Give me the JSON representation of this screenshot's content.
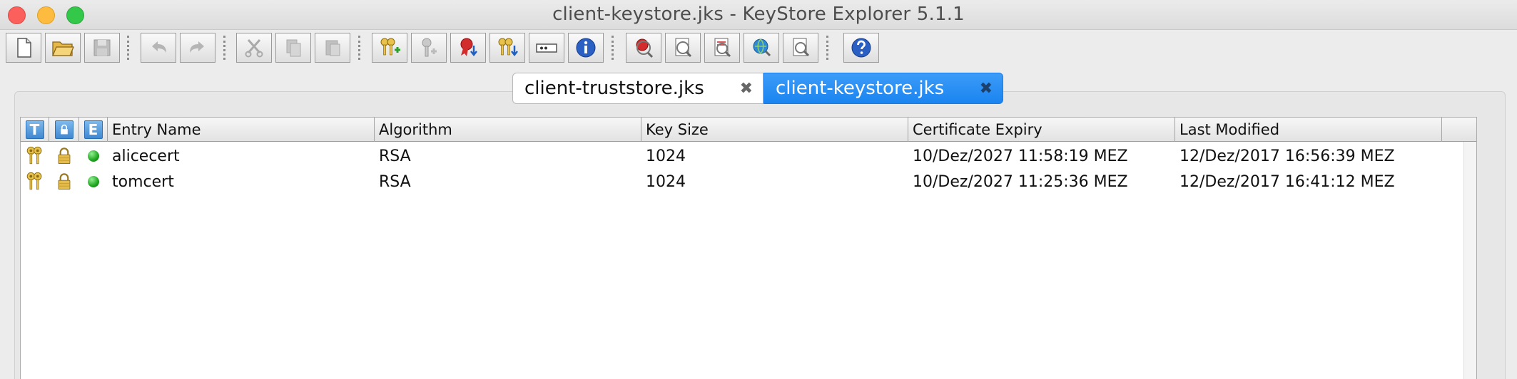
{
  "window": {
    "title": "client-keystore.jks - KeyStore Explorer 5.1.1"
  },
  "toolbar": {
    "buttons": [
      {
        "name": "new-keystore",
        "icon": "new-file-icon",
        "enabled": true
      },
      {
        "name": "open-keystore",
        "icon": "open-folder-icon",
        "enabled": true
      },
      {
        "name": "save-keystore",
        "icon": "save-disk-icon",
        "enabled": false
      },
      {
        "name": "undo",
        "icon": "undo-icon",
        "enabled": false
      },
      {
        "name": "redo",
        "icon": "redo-icon",
        "enabled": false
      },
      {
        "name": "cut",
        "icon": "scissors-icon",
        "enabled": false
      },
      {
        "name": "copy",
        "icon": "copy-icon",
        "enabled": false
      },
      {
        "name": "paste",
        "icon": "paste-icon",
        "enabled": false
      },
      {
        "name": "generate-keypair",
        "icon": "keypair-add-icon",
        "enabled": true
      },
      {
        "name": "generate-secret-key",
        "icon": "key-add-icon",
        "enabled": false
      },
      {
        "name": "import-trusted-cert",
        "icon": "certificate-import-icon",
        "enabled": true
      },
      {
        "name": "import-keypair",
        "icon": "keypair-import-icon",
        "enabled": true
      },
      {
        "name": "set-password",
        "icon": "password-icon",
        "enabled": true
      },
      {
        "name": "keystore-properties",
        "icon": "info-icon",
        "enabled": true
      },
      {
        "name": "examine-certificate",
        "icon": "examine-certificate-icon",
        "enabled": true
      },
      {
        "name": "examine-csr",
        "icon": "examine-csr-icon",
        "enabled": true
      },
      {
        "name": "examine-crl",
        "icon": "examine-crl-icon",
        "enabled": true
      },
      {
        "name": "examine-ssl",
        "icon": "examine-ssl-icon",
        "enabled": true
      },
      {
        "name": "examine-clipboard",
        "icon": "examine-clipboard-icon",
        "enabled": true
      },
      {
        "name": "help",
        "icon": "help-icon",
        "enabled": true
      }
    ]
  },
  "tabs": [
    {
      "label": "client-truststore.jks",
      "close": "✖",
      "active": false
    },
    {
      "label": "client-keystore.jks",
      "close": "✖",
      "active": true
    }
  ],
  "table": {
    "icon_headers": [
      "T",
      "🔒",
      "E"
    ],
    "columns": [
      "Entry Name",
      "Algorithm",
      "Key Size",
      "Certificate Expiry",
      "Last Modified"
    ],
    "rows": [
      {
        "type_icon": "keypair-icon",
        "lock_icon": "lock-icon",
        "expiry_status": "valid-green-icon",
        "entry_name": "alicecert",
        "algorithm": "RSA",
        "key_size": "1024",
        "certificate_expiry": "10/Dez/2027 11:58:19 MEZ",
        "last_modified": "12/Dez/2017 16:56:39 MEZ"
      },
      {
        "type_icon": "keypair-icon",
        "lock_icon": "lock-icon",
        "expiry_status": "valid-green-icon",
        "entry_name": "tomcert",
        "algorithm": "RSA",
        "key_size": "1024",
        "certificate_expiry": "10/Dez/2027 11:25:36 MEZ",
        "last_modified": "12/Dez/2017 16:41:12 MEZ"
      }
    ]
  },
  "colors": {
    "tab_active": "#1a84f0",
    "header_icon": "#3f88d1",
    "status_green": "#1fa51f"
  }
}
